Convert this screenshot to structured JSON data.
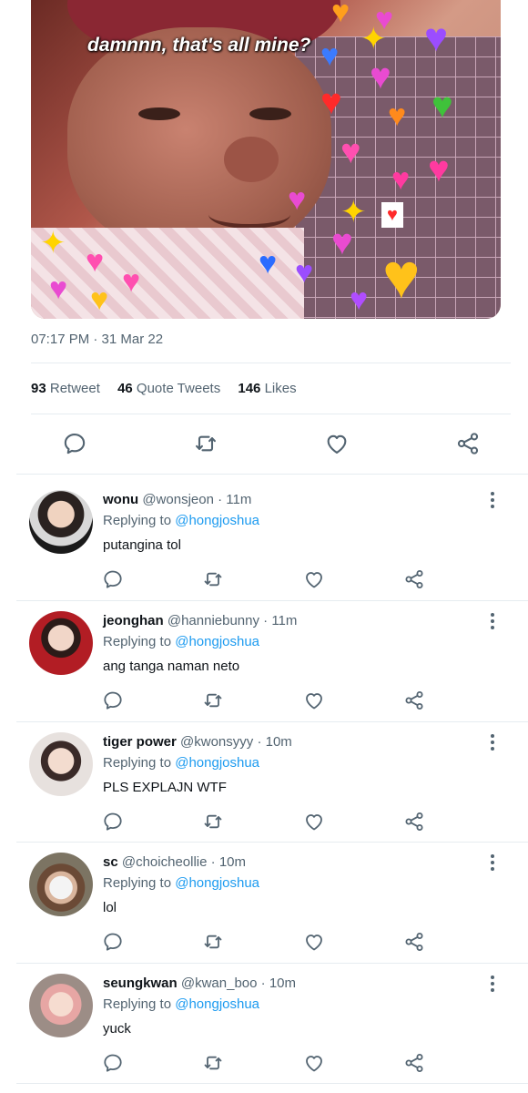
{
  "tweet": {
    "image_caption": "damnnn, that's all mine?",
    "timestamp": "07:17 PM · 31 Mar 22",
    "stats": [
      {
        "count": "93",
        "label": "Retweet"
      },
      {
        "count": "46",
        "label": "Quote Tweets"
      },
      {
        "count": "146",
        "label": "Likes"
      }
    ]
  },
  "colors": {
    "accent": "#1d9bf0",
    "muted": "#536471",
    "text": "#0f1419",
    "divider": "#e6ecf0"
  },
  "replies": [
    {
      "name": "wonu",
      "handle": "@wonsjeon",
      "sep": "·",
      "time": "11m",
      "replying_prefix": "Replying to",
      "replying_to": "@hongjoshua",
      "text": "putangina tol"
    },
    {
      "name": "jeonghan",
      "handle": "@hanniebunny",
      "sep": "·",
      "time": "11m",
      "replying_prefix": "Replying to",
      "replying_to": "@hongjoshua",
      "text": "ang tanga naman neto"
    },
    {
      "name": "tiger power",
      "handle": "@kwonsyyy",
      "sep": "·",
      "time": "10m",
      "replying_prefix": "Replying to",
      "replying_to": "@hongjoshua",
      "text": "PLS EXPLAJN WTF"
    },
    {
      "name": "sc",
      "handle": "@choicheollie",
      "sep": "·",
      "time": "10m",
      "replying_prefix": "Replying to",
      "replying_to": "@hongjoshua",
      "text": "lol"
    },
    {
      "name": "seungkwan",
      "handle": "@kwan_boo",
      "sep": "·",
      "time": "10m",
      "replying_prefix": "Replying to",
      "replying_to": "@hongjoshua",
      "text": "yuck"
    }
  ],
  "icons": {
    "reply": "reply-icon",
    "retweet": "retweet-icon",
    "like": "like-icon",
    "share": "share-icon",
    "more": "more-options-icon"
  }
}
